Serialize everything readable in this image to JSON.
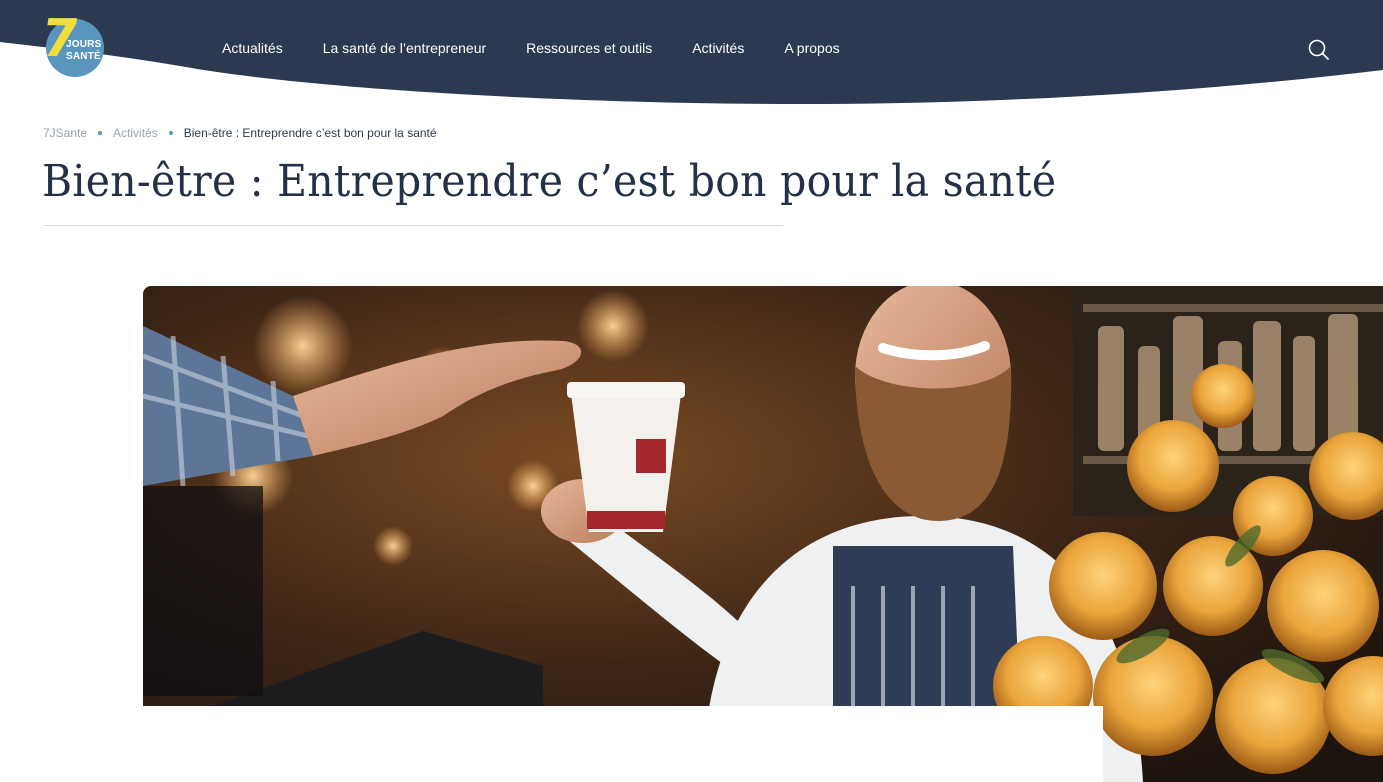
{
  "brand": {
    "logo_number": "7",
    "logo_line1": "JOURS",
    "logo_line2": "SANTÉ",
    "colors": {
      "navy": "#2b3a51",
      "blue": "#5a95bd",
      "yellow": "#f0df3b"
    }
  },
  "nav": {
    "items": [
      {
        "label": "Actualités"
      },
      {
        "label": "La santé de l’entrepreneur"
      },
      {
        "label": "Ressources et outils"
      },
      {
        "label": "Activités"
      },
      {
        "label": "A propos"
      }
    ],
    "search_icon": "search-icon"
  },
  "breadcrumb": {
    "items": [
      "7JSante",
      "Activités"
    ],
    "current": "Bien-être : Entreprendre c’est bon pour la santé"
  },
  "article": {
    "title": "Bien-être : Entreprendre c’est bon pour la santé",
    "hero_image": "barista-serving-coffee-photo"
  }
}
